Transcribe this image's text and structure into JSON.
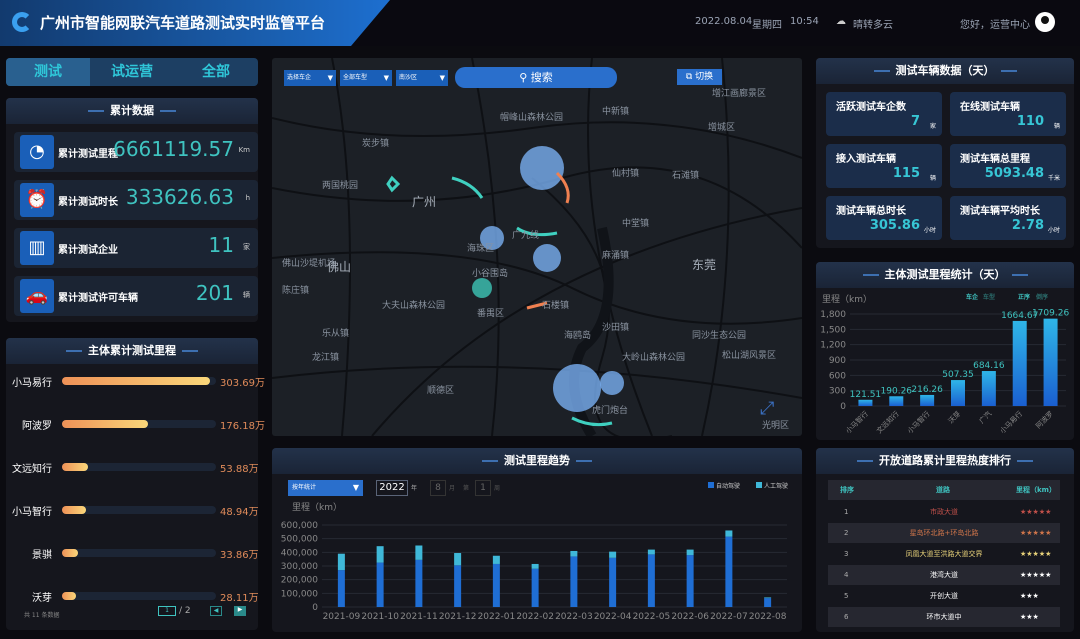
{
  "header": {
    "title": "广州市智能网联汽车道路测试实时监管平台",
    "date": "2022.08.04",
    "weekday": "星期四",
    "time": "10:54",
    "weather": "晴转多云",
    "greeting": "您好，运营中心"
  },
  "tabs": [
    {
      "label": "测试",
      "active": true
    },
    {
      "label": "试运营"
    },
    {
      "label": "全部"
    }
  ],
  "cumulative": {
    "title": "累计数据",
    "items": [
      {
        "label": "累计测试里程",
        "value": "6661119.57",
        "unit": "Km",
        "icon": "stopwatch-icon"
      },
      {
        "label": "累计测试时长",
        "value": "333626.63",
        "unit": "h",
        "icon": "alarm-clock-icon"
      },
      {
        "label": "累计测试企业",
        "value": "11",
        "unit": "家",
        "icon": "building-icon"
      },
      {
        "label": "累计测试许可车辆",
        "value": "201",
        "unit": "辆",
        "icon": "car-icon"
      }
    ]
  },
  "entity_mileage": {
    "title": "主体累计测试里程",
    "items": [
      {
        "name": "小马易行",
        "value": 303.69,
        "label": "303.69万"
      },
      {
        "name": "阿波罗",
        "value": 176.18,
        "label": "176.18万"
      },
      {
        "name": "文远知行",
        "value": 53.88,
        "label": "53.88万"
      },
      {
        "name": "小马智行",
        "value": 48.94,
        "label": "48.94万"
      },
      {
        "name": "景骐",
        "value": 33.86,
        "label": "33.86万"
      },
      {
        "name": "沃芽",
        "value": 28.11,
        "label": "28.11万"
      }
    ],
    "total_text": "共 11 条数据",
    "page": "1",
    "pages": "/ 2"
  },
  "map": {
    "filters": [
      "选择车企",
      "全部车型",
      "南沙区"
    ],
    "search_label": "搜索",
    "switch_label": "切换",
    "labels": [
      "增江画廊景区",
      "帽峰山森林公园",
      "中新镇",
      "增城区",
      "炭步镇",
      "仙村镇",
      "石滩镇",
      "两国桃园",
      "广州",
      "海珠区",
      "广九线",
      "佛山沙堤机场",
      "中堂镇",
      "麻涌镇",
      "佛山",
      "东莞",
      "小谷围岛",
      "石楼镇",
      "大夫山森林公园",
      "番禺区",
      "同沙生态公园",
      "沙田镇",
      "海鸥岛",
      "龙江镇",
      "大岭山森林公园",
      "松山湖风景区",
      "顺德区",
      "虎门炮台",
      "光明区",
      "乐从镇",
      "陈庄镇"
    ]
  },
  "vehicle_data": {
    "title": "测试车辆数据（天）",
    "items": [
      {
        "label": "活跃测试车企数",
        "value": "7",
        "unit": "家"
      },
      {
        "label": "在线测试车辆",
        "value": "110",
        "unit": "辆"
      },
      {
        "label": "接入测试车辆",
        "value": "115",
        "unit": "辆"
      },
      {
        "label": "测试车辆总里程",
        "value": "5093.48",
        "unit": "千米"
      },
      {
        "label": "测试车辆总时长",
        "value": "305.86",
        "unit": "小时"
      },
      {
        "label": "测试车辆平均时长",
        "value": "2.78",
        "unit": "小时"
      }
    ]
  },
  "ranking": {
    "title": "开放道路累计里程热度排行",
    "headers": [
      "排序",
      "道路",
      "里程（km）"
    ],
    "rows": [
      {
        "rank": "1",
        "road": "市政大道",
        "stars": "★★★★★",
        "color": "#c0504a"
      },
      {
        "rank": "2",
        "road": "星岛环北路+环岛北路",
        "stars": "★★★★★",
        "color": "#d0754a"
      },
      {
        "rank": "3",
        "road": "凤凰大道至洪路大道交界",
        "stars": "★★★★★",
        "color": "#e8d27a"
      },
      {
        "rank": "4",
        "road": "港湾大道",
        "stars": "★★★★★",
        "color": "#ffffff"
      },
      {
        "rank": "5",
        "road": "开创大道",
        "stars": "★★★",
        "color": "#ffffff"
      },
      {
        "rank": "6",
        "road": "环市大道中",
        "stars": "★★★",
        "color": "#ffffff"
      }
    ]
  },
  "chart_data": [
    {
      "type": "bar",
      "title": "主体测试里程统计（天）",
      "ylabel": "里程（km）",
      "ylim": [
        0,
        1800
      ],
      "yticks": [
        0,
        300,
        600,
        900,
        1200,
        1500,
        1800
      ],
      "categories": [
        "小马智行",
        "文远知行",
        "小马智行",
        "沃芽",
        "广汽",
        "小马易行",
        "阿波罗"
      ],
      "values": [
        121.51,
        190.26,
        216.26,
        507.35,
        684.16,
        1664.67,
        1709.26
      ],
      "legend_toggles": [
        "车企",
        "车型",
        "正序",
        "倒序"
      ],
      "colors": {
        "bar_top": "#2fb6e8",
        "bar_bottom": "#1a5fd0"
      }
    },
    {
      "type": "bar",
      "stacked": true,
      "title": "测试里程趋势",
      "ylabel": "里程（km）",
      "ylim": [
        0,
        600000
      ],
      "yticks": [
        0,
        100000,
        200000,
        300000,
        400000,
        500000,
        600000
      ],
      "controls": {
        "mode": "按年统计",
        "year": "2022",
        "year_unit": "年",
        "month": "8",
        "month_unit": "月",
        "week_prefix": "第",
        "week": "1",
        "week_unit": "周"
      },
      "categories": [
        "2021-09",
        "2021-10",
        "2021-11",
        "2021-12",
        "2022-01",
        "2022-02",
        "2022-03",
        "2022-04",
        "2022-05",
        "2022-06",
        "2022-07",
        "2022-08"
      ],
      "series": [
        {
          "name": "自动驾驶",
          "color": "#1f6ed4",
          "values": [
            270000,
            325000,
            345000,
            305000,
            315000,
            280000,
            370000,
            360000,
            385000,
            380000,
            515000,
            65000
          ]
        },
        {
          "name": "人工驾驶",
          "color": "#3fb8d8",
          "values": [
            120000,
            120000,
            105000,
            90000,
            60000,
            35000,
            40000,
            45000,
            35000,
            40000,
            45000,
            5000
          ]
        }
      ]
    }
  ]
}
